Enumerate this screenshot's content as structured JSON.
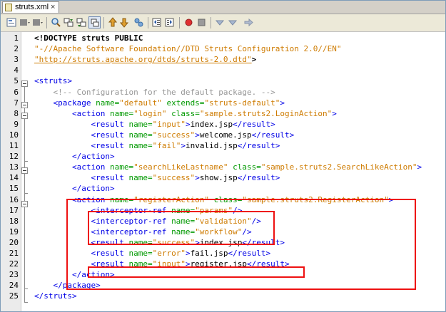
{
  "tab": {
    "label": "struts.xml",
    "close": "×"
  },
  "toolbar": {
    "buttons": [
      "source-view",
      "history",
      "back",
      "find",
      "find-previous",
      "find-next",
      "toggle-highlight",
      "previous-bookmark",
      "next-bookmark",
      "toggle-bookmark",
      "shift-left",
      "shift-right",
      "start-macro",
      "stop-macro",
      "comment",
      "uncomment",
      "check-xml"
    ]
  },
  "editor": {
    "line_numbers": [
      "1",
      "2",
      "3",
      "4",
      "5",
      "6",
      "7",
      "8",
      "9",
      "10",
      "11",
      "12",
      "13",
      "14",
      "15",
      "16",
      "17",
      "18",
      "19",
      "20",
      "21",
      "22",
      "23",
      "24",
      "25"
    ],
    "lines": [
      [
        {
          "c": "dt",
          "t": "<!DOCTYPE struts PUBLIC"
        }
      ],
      [
        {
          "c": "str",
          "t": "\"-//Apache Software Foundation//DTD Struts Configuration 2.0//EN\""
        }
      ],
      [
        {
          "c": "lnk",
          "t": "\"http://struts.apache.org/dtds/struts-2.0.dtd\""
        },
        {
          "c": "dt",
          "t": ">"
        }
      ],
      [],
      [
        {
          "c": "t",
          "t": "<struts>"
        }
      ],
      [
        {
          "c": "cm",
          "t": "    <!-- Configuration for the default package. -->"
        }
      ],
      [
        {
          "c": "t",
          "t": "    <package "
        },
        {
          "c": "an",
          "t": "name="
        },
        {
          "c": "av",
          "t": "\"default\""
        },
        {
          "c": "an",
          "t": " extends="
        },
        {
          "c": "av",
          "t": "\"struts-default\""
        },
        {
          "c": "t",
          "t": ">"
        }
      ],
      [
        {
          "c": "t",
          "t": "        <action "
        },
        {
          "c": "an",
          "t": "name="
        },
        {
          "c": "av",
          "t": "\"login\""
        },
        {
          "c": "an",
          "t": " class="
        },
        {
          "c": "av",
          "t": "\"sample.struts2.LoginAction\""
        },
        {
          "c": "t",
          "t": ">"
        }
      ],
      [
        {
          "c": "t",
          "t": "            <result "
        },
        {
          "c": "an",
          "t": "name="
        },
        {
          "c": "av",
          "t": "\"input\""
        },
        {
          "c": "t",
          "t": ">"
        },
        {
          "c": "tx",
          "t": "index.jsp"
        },
        {
          "c": "t",
          "t": "</result>"
        }
      ],
      [
        {
          "c": "t",
          "t": "            <result "
        },
        {
          "c": "an",
          "t": "name="
        },
        {
          "c": "av",
          "t": "\"success\""
        },
        {
          "c": "t",
          "t": ">"
        },
        {
          "c": "tx",
          "t": "welcome.jsp"
        },
        {
          "c": "t",
          "t": "</result>"
        }
      ],
      [
        {
          "c": "t",
          "t": "            <result "
        },
        {
          "c": "an",
          "t": "name="
        },
        {
          "c": "av",
          "t": "\"fail\""
        },
        {
          "c": "t",
          "t": ">"
        },
        {
          "c": "tx",
          "t": "invalid.jsp"
        },
        {
          "c": "t",
          "t": "</result>"
        }
      ],
      [
        {
          "c": "t",
          "t": "        </action>"
        }
      ],
      [
        {
          "c": "t",
          "t": "        <action "
        },
        {
          "c": "an",
          "t": "name="
        },
        {
          "c": "av",
          "t": "\"searchLikeLastname\""
        },
        {
          "c": "an",
          "t": " class="
        },
        {
          "c": "av",
          "t": "\"sample.struts2.SearchLikeAction\""
        },
        {
          "c": "t",
          "t": ">"
        }
      ],
      [
        {
          "c": "t",
          "t": "            <result "
        },
        {
          "c": "an",
          "t": "name="
        },
        {
          "c": "av",
          "t": "\"success\""
        },
        {
          "c": "t",
          "t": ">"
        },
        {
          "c": "tx",
          "t": "show.jsp"
        },
        {
          "c": "t",
          "t": "</result>"
        }
      ],
      [
        {
          "c": "t",
          "t": "        </action>"
        }
      ],
      [
        {
          "c": "t",
          "t": "        <action "
        },
        {
          "c": "an",
          "t": "name="
        },
        {
          "c": "av",
          "t": "\"registerAction\""
        },
        {
          "c": "an",
          "t": " class="
        },
        {
          "c": "av",
          "t": "\"sample.struts2.RegisterAction\""
        },
        {
          "c": "t",
          "t": ">"
        }
      ],
      [
        {
          "c": "t",
          "t": "            <interceptor-ref "
        },
        {
          "c": "an",
          "t": "name="
        },
        {
          "c": "av",
          "t": "\"params\""
        },
        {
          "c": "t",
          "t": "/>"
        }
      ],
      [
        {
          "c": "t",
          "t": "            <interceptor-ref "
        },
        {
          "c": "an",
          "t": "name="
        },
        {
          "c": "av",
          "t": "\"validation\""
        },
        {
          "c": "t",
          "t": "/>"
        }
      ],
      [
        {
          "c": "t",
          "t": "            <interceptor-ref "
        },
        {
          "c": "an",
          "t": "name="
        },
        {
          "c": "av",
          "t": "\"workflow\""
        },
        {
          "c": "t",
          "t": "/>"
        }
      ],
      [
        {
          "c": "t",
          "t": "            <result "
        },
        {
          "c": "an",
          "t": "name="
        },
        {
          "c": "av",
          "t": "\"success\""
        },
        {
          "c": "t",
          "t": ">"
        },
        {
          "c": "tx",
          "t": "index.jsp"
        },
        {
          "c": "t",
          "t": "</result>"
        }
      ],
      [
        {
          "c": "t",
          "t": "            <result "
        },
        {
          "c": "an",
          "t": "name="
        },
        {
          "c": "av",
          "t": "\"error\""
        },
        {
          "c": "t",
          "t": ">"
        },
        {
          "c": "tx",
          "t": "fail.jsp"
        },
        {
          "c": "t",
          "t": "</result>"
        }
      ],
      [
        {
          "c": "t",
          "t": "            <result "
        },
        {
          "c": "an",
          "t": "name="
        },
        {
          "c": "av",
          "t": "\"input\""
        },
        {
          "c": "t",
          "t": ">"
        },
        {
          "c": "tx",
          "t": "register.jsp"
        },
        {
          "c": "t",
          "t": "</result>"
        }
      ],
      [
        {
          "c": "t",
          "t": "        </action>"
        }
      ],
      [
        {
          "c": "t",
          "t": "    </package>"
        }
      ],
      [
        {
          "c": "t",
          "t": "</struts>"
        }
      ]
    ]
  },
  "colors": {
    "tag": "#0000e6",
    "attribute_name": "#009900",
    "attribute_value": "#ce7b00",
    "comment": "#969696",
    "highlight_box": "#ee1111"
  }
}
